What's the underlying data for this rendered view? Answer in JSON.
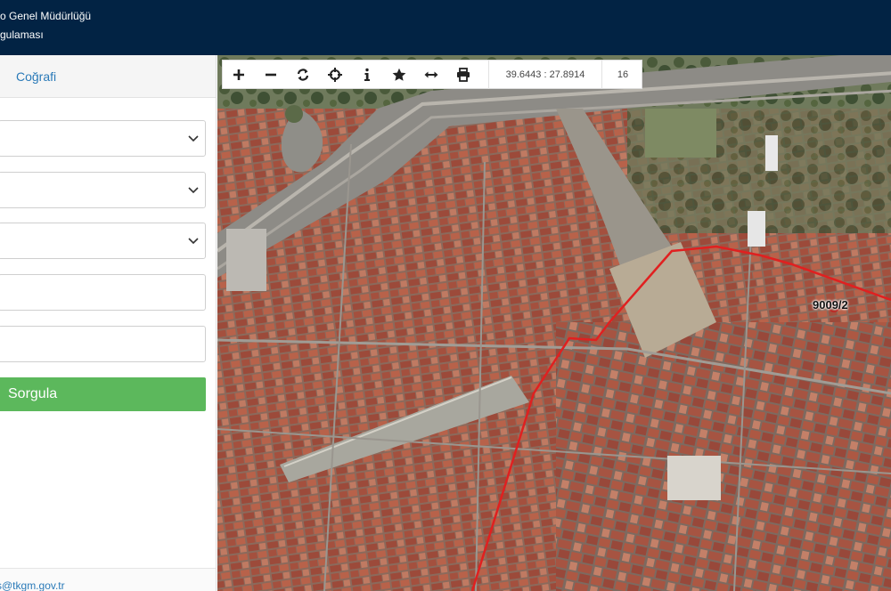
{
  "header": {
    "title": "o Genel Müdürlüğü",
    "subtitle": "gulaması"
  },
  "sidebar": {
    "tab_label": "Coğrafi",
    "query_button": "Sorgula",
    "footer_email": "s@tkgm.gov.tr"
  },
  "map": {
    "coordinates": "39.6443 : 27.8914",
    "zoom_level": "16",
    "parcel_label": "9009/2",
    "boundary_color": "#e02020"
  }
}
